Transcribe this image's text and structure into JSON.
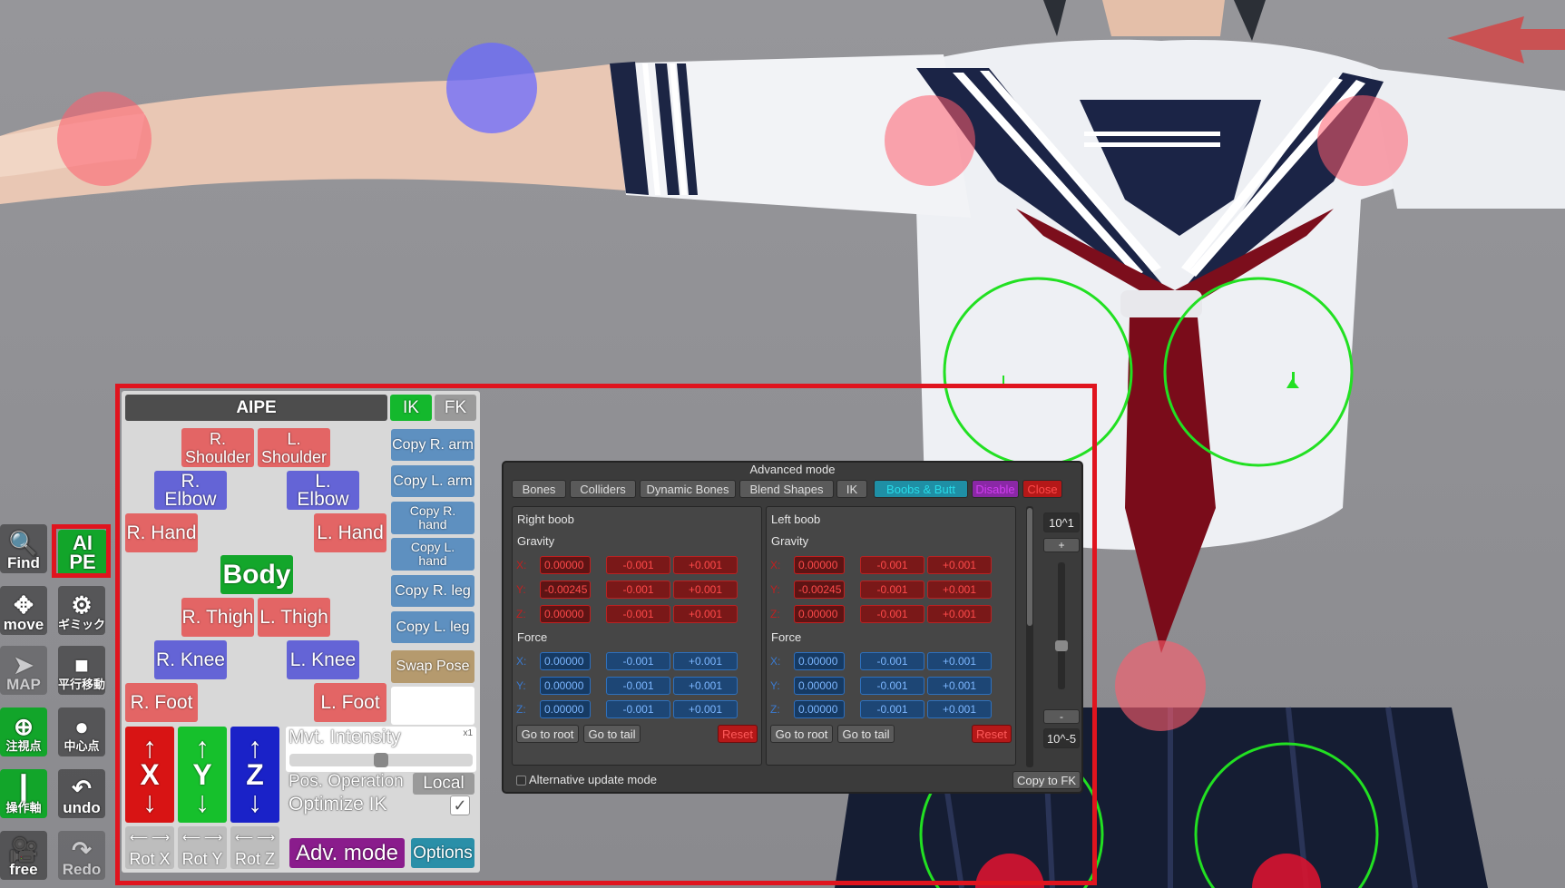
{
  "colors": {
    "panel_bg": "#d8d8d8",
    "pink": "#e36565",
    "purple": "#6464d6",
    "steel": "#5e90c0",
    "ik_green": "#14b82d",
    "x_axis": "#d81414",
    "y_axis": "#16c02c",
    "z_axis": "#1a22c8",
    "adv_mode": "#8a1c8c",
    "options": "#2a8fa8",
    "selection_red": "#e0141e"
  },
  "toolbar": {
    "find": "Find",
    "aipe_top": "AI",
    "aipe_bottom": "PE",
    "move": "move",
    "gimmick": "ギミック",
    "map": "MAP",
    "translate": "平行移動",
    "focus": "注視点",
    "center": "中心点",
    "axis": "操作軸",
    "undo": "undo",
    "free": "free",
    "redo": "Redo"
  },
  "aipe": {
    "title": "AIPE",
    "ik": "IK",
    "fk": "FK",
    "r_shoulder": "R.\nShoulder",
    "l_shoulder": "L.\nShoulder",
    "r_elbow": "R. Elbow",
    "l_elbow": "L. Elbow",
    "r_hand": "R. Hand",
    "l_hand": "L. Hand",
    "body": "Body",
    "r_thigh": "R. Thigh",
    "l_thigh": "L. Thigh",
    "r_knee": "R. Knee",
    "l_knee": "L. Knee",
    "r_foot": "R. Foot",
    "l_foot": "L. Foot",
    "copy_r_arm": "Copy R. arm",
    "copy_l_arm": "Copy L. arm",
    "copy_r_hand": "Copy R.\nhand",
    "copy_l_hand": "Copy L.\nhand",
    "copy_r_leg": "Copy R. leg",
    "copy_l_leg": "Copy L. leg",
    "swap_pose": "Swap Pose",
    "axis_x": "X",
    "axis_y": "Y",
    "axis_z": "Z",
    "rot_x": "Rot X",
    "rot_y": "Rot Y",
    "rot_z": "Rot Z",
    "mvt_intensity": "Mvt. Intensity",
    "mvt_multiplier": "x1",
    "mvt_intensity_value": 0.5,
    "pos_operation": "Pos. Operation",
    "local": "Local",
    "optimize_ik": "Optimize IK",
    "optimize_check": "✓",
    "adv_mode": "Adv. mode",
    "options": "Options"
  },
  "advanced": {
    "title": "Advanced mode",
    "tabs": [
      "Bones",
      "Colliders",
      "Dynamic Bones",
      "Blend Shapes",
      "IK",
      "Boobs & Butt",
      "Disable",
      "Close"
    ],
    "right": {
      "title": "Right boob",
      "gravity": "Gravity",
      "gx": "0.00000",
      "gy": "-0.00245",
      "gz": "0.00000",
      "force": "Force",
      "fx": "0.00000",
      "fy": "0.00000",
      "fz": "0.00000"
    },
    "left": {
      "title": "Left boob",
      "gravity": "Gravity",
      "gx": "0.00000",
      "gy": "-0.00245",
      "gz": "0.00000",
      "force": "Force",
      "fx": "0.00000",
      "fy": "0.00000",
      "fz": "0.00000"
    },
    "minus": "-0.001",
    "plus": "+0.001",
    "ax_x": "X:",
    "ax_y": "Y:",
    "ax_z": "Z:",
    "go_root": "Go to root",
    "go_tail": "Go to tail",
    "reset": "Reset",
    "scale_top": "10^1",
    "scale_bottom": "10^-5",
    "plus_btn": "+",
    "minus_btn": "-",
    "scale_value": 0.67,
    "alt_update": "Alternative update mode",
    "copy_to_fk": "Copy to FK"
  }
}
